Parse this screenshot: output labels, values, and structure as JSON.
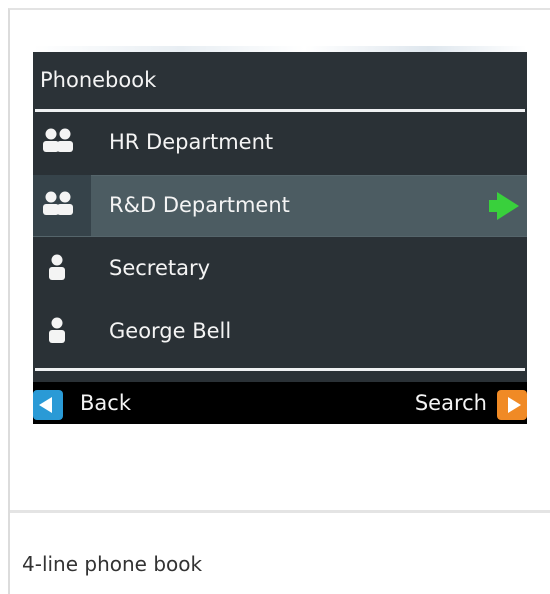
{
  "phone_screen": {
    "title": "Phonebook",
    "entries": [
      {
        "label": "HR Department",
        "icon": "group-icon",
        "selected": false
      },
      {
        "label": "R&D Department",
        "icon": "group-icon",
        "selected": true
      },
      {
        "label": "Secretary",
        "icon": "person-icon",
        "selected": false
      },
      {
        "label": "George Bell",
        "icon": "person-icon",
        "selected": false
      }
    ],
    "softkeys": {
      "left_label": "Back",
      "right_label": "Search"
    },
    "colors": {
      "selection_arrow": "#39d03c",
      "back_key": "#2a9ad6",
      "search_key": "#f08a25"
    }
  },
  "caption": "4-line phone book"
}
